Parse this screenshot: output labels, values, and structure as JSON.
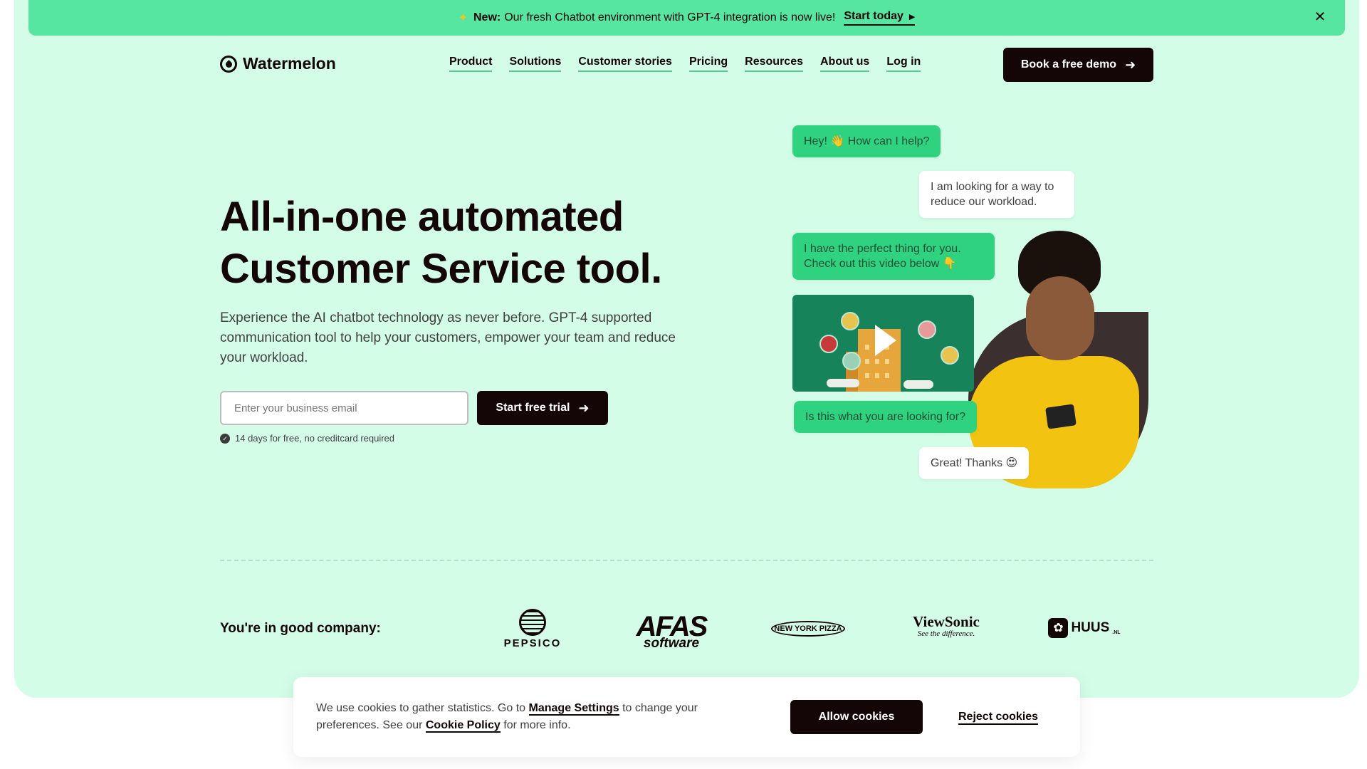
{
  "announcement": {
    "icon": "sparkle-icon",
    "new_label": "New:",
    "message": "Our fresh Chatbot environment with GPT-4 integration is now live!",
    "cta": "Start today"
  },
  "header": {
    "brand": "Watermelon",
    "nav": [
      "Product",
      "Solutions",
      "Customer stories",
      "Pricing",
      "Resources",
      "About us",
      "Log in"
    ],
    "demo_button": "Book a free demo"
  },
  "hero": {
    "title_line1": "All-in-one automated",
    "title_line2": "Customer Service tool",
    "title_dot": ".",
    "subtitle": "Experience the AI chatbot technology as never before. GPT-4 supported communication tool to help your customers, empower your team and reduce your workload.",
    "email_placeholder": "Enter your business email",
    "trial_button": "Start free trial",
    "trial_note": "14 days for free, no creditcard required"
  },
  "chat": {
    "messages": [
      {
        "from": "bot",
        "text": "Hey! 👋 How can I help?"
      },
      {
        "from": "user",
        "text": "I am looking for a way to reduce our workload."
      },
      {
        "from": "bot",
        "text": "I have the perfect thing for you. Check out this video below 👇"
      },
      {
        "from": "bot",
        "text": "Is this what you are looking for?"
      },
      {
        "from": "user",
        "text": "Great! Thanks 😍"
      }
    ]
  },
  "company": {
    "label": "You're in good company:",
    "logos": {
      "pepsico": "PEPSICO",
      "afas": "AFAS",
      "afas_sub": "software",
      "nyp": "NEW YORK PIZZA",
      "viewsonic": "ViewSonic",
      "viewsonic_tag": "See the difference.",
      "huus": "HUUS",
      "huus_tld": ".NL"
    }
  },
  "cookie": {
    "text_pre": "We use cookies to gather statistics. Go to",
    "manage_link": "Manage Settings",
    "text_mid": "to change your preferences. See our",
    "policy_link": "Cookie Policy",
    "text_post": "for more info.",
    "allow": "Allow cookies",
    "reject": "Reject cookies"
  },
  "colors": {
    "page_bg": "#d3fde7",
    "announce_bg": "#57e6a1",
    "bot_bubble": "#2fd27e",
    "dark": "#140606"
  }
}
